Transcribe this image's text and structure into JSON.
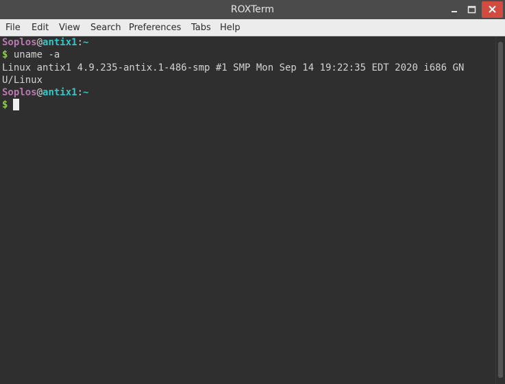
{
  "window": {
    "title": "ROXTerm",
    "colors": {
      "titlebar_bg": "#4b4b4b",
      "close_button": "#d34b3f",
      "terminal_bg": "#2f2f2f",
      "menubar_bg": "#ececec"
    }
  },
  "menubar": {
    "items": [
      {
        "label": "File"
      },
      {
        "label": "Edit"
      },
      {
        "label": "View"
      },
      {
        "label": "Search"
      },
      {
        "label": "Preferences"
      },
      {
        "label": "Tabs"
      },
      {
        "label": "Help"
      }
    ]
  },
  "terminal": {
    "prompt1": {
      "user": "Soplos",
      "at": "@",
      "host": "antix1",
      "colon": ":",
      "path": "~"
    },
    "line2": {
      "dollar": "$",
      "command": " uname -a"
    },
    "line3": "Linux antix1 4.9.235-antix.1-486-smp #1 SMP Mon Sep 14 19:22:35 EDT 2020 i686 GN",
    "line4": "U/Linux",
    "prompt2": {
      "user": "Soplos",
      "at": "@",
      "host": "antix1",
      "colon": ":",
      "path": "~"
    },
    "line6": {
      "dollar": "$"
    },
    "colors": {
      "user": "#b978b1",
      "host": "#34c7c8",
      "dollar": "#8ad43a",
      "text": "#d3d3d3"
    }
  },
  "icons": {
    "minimize": "minimize-icon",
    "maximize": "maximize-icon",
    "close": "close-icon"
  }
}
